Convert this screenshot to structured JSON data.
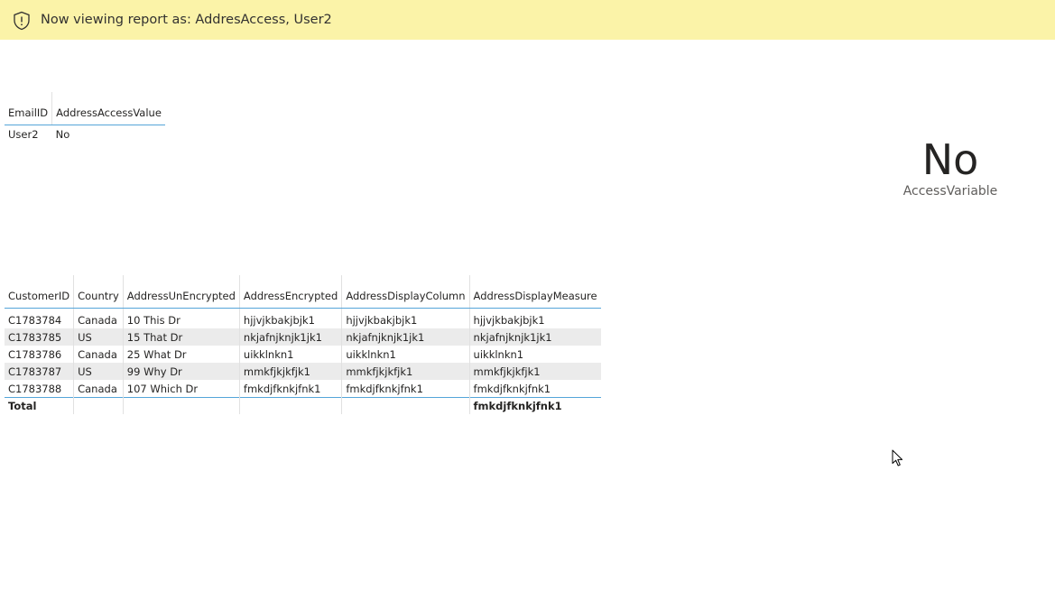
{
  "banner": {
    "text": "Now viewing report as: AddresAccess, User2",
    "icon": "shield-alert-icon"
  },
  "access_table": {
    "headers": [
      "EmailID",
      "AddressAccessValue"
    ],
    "rows": [
      [
        "User2",
        "No"
      ]
    ]
  },
  "card": {
    "value": "No",
    "label": "AccessVariable"
  },
  "customer_table": {
    "headers": [
      "CustomerID",
      "Country",
      "AddressUnEncrypted",
      "AddressEncrypted",
      "AddressDisplayColumn",
      "AddressDisplayMeasure"
    ],
    "rows": [
      [
        "C1783784",
        "Canada",
        "10 This Dr",
        "hjjvjkbakjbjk1",
        "hjjvjkbakjbjk1",
        "hjjvjkbakjbjk1"
      ],
      [
        "C1783785",
        "US",
        "15 That Dr",
        "nkjafnjknjk1jk1",
        "nkjafnjknjk1jk1",
        "nkjafnjknjk1jk1"
      ],
      [
        "C1783786",
        "Canada",
        "25 What Dr",
        "uikklnkn1",
        "uikklnkn1",
        "uikklnkn1"
      ],
      [
        "C1783787",
        "US",
        "99 Why Dr",
        "mmkfjkjkfjk1",
        "mmkfjkjkfjk1",
        "mmkfjkjkfjk1"
      ],
      [
        "C1783788",
        "Canada",
        "107 Which Dr",
        "fmkdjfknkjfnk1",
        "fmkdjfknkjfnk1",
        "fmkdjfknkjfnk1"
      ]
    ],
    "total": [
      "Total",
      "",
      "",
      "",
      "",
      "fmkdjfknkjfnk1"
    ]
  },
  "colors": {
    "banner_bg": "#fbf3a8",
    "header_rule": "#55a5d9",
    "alt_row": "#ebebeb"
  }
}
